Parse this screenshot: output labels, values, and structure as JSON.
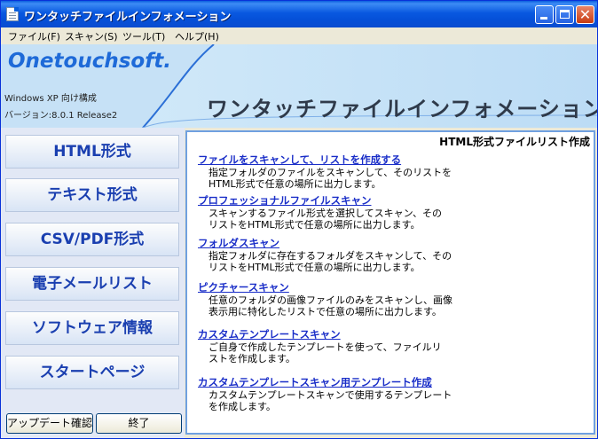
{
  "window": {
    "title": "ワンタッチファイルインフォメーション"
  },
  "menu": [
    {
      "label": "ファイル(F)"
    },
    {
      "label": "スキャン(S)"
    },
    {
      "label": "ツール(T)"
    },
    {
      "label": "ヘルプ(H)"
    }
  ],
  "banner": {
    "brand": "Onetouchsoft.",
    "build": "Windows XP 向け構成",
    "version": "バージョン:8.0.1 Release2",
    "title": "ワンタッチファイルインフォメーション"
  },
  "sidebar": {
    "items": [
      {
        "label": "HTML形式"
      },
      {
        "label": "テキスト形式"
      },
      {
        "label": "CSV/PDF形式"
      },
      {
        "label": "電子メールリスト"
      },
      {
        "label": "ソフトウェア情報"
      },
      {
        "label": "スタートページ"
      }
    ],
    "update_label": "アップデート確認",
    "exit_label": "終了"
  },
  "content": {
    "header": "HTML形式ファイルリスト作成",
    "sections": [
      {
        "link": "ファイルをスキャンして、リストを作成する",
        "desc1": "指定フォルダのファイルをスキャンして、そのリストを",
        "desc2": "HTML形式で任意の場所に出力します。"
      },
      {
        "link": "プロフェッショナルファイルスキャン",
        "desc1": "スキャンするファイル形式を選択してスキャン、その",
        "desc2": "リストをHTML形式で任意の場所に出力します。"
      },
      {
        "link": "フォルダスキャン",
        "desc1": "指定フォルダに存在するフォルダをスキャンして、その",
        "desc2": "リストをHTML形式で任意の場所に出力します。"
      },
      {
        "link": "ピクチャースキャン",
        "desc1": "任意のフォルダの画像ファイルのみをスキャンし、画像",
        "desc2": "表示用に特化したリストで任意の場所に出力します。"
      },
      {
        "link": "カスタムテンプレートスキャン",
        "desc1": "ご自身で作成したテンプレートを使って、ファイルリ",
        "desc2": "ストを作成します。"
      },
      {
        "link": "カスタムテンプレートスキャン用テンプレート作成",
        "desc1": "カスタムテンプレートスキャンで使用するテンプレート",
        "desc2": "を作成します。"
      }
    ]
  }
}
